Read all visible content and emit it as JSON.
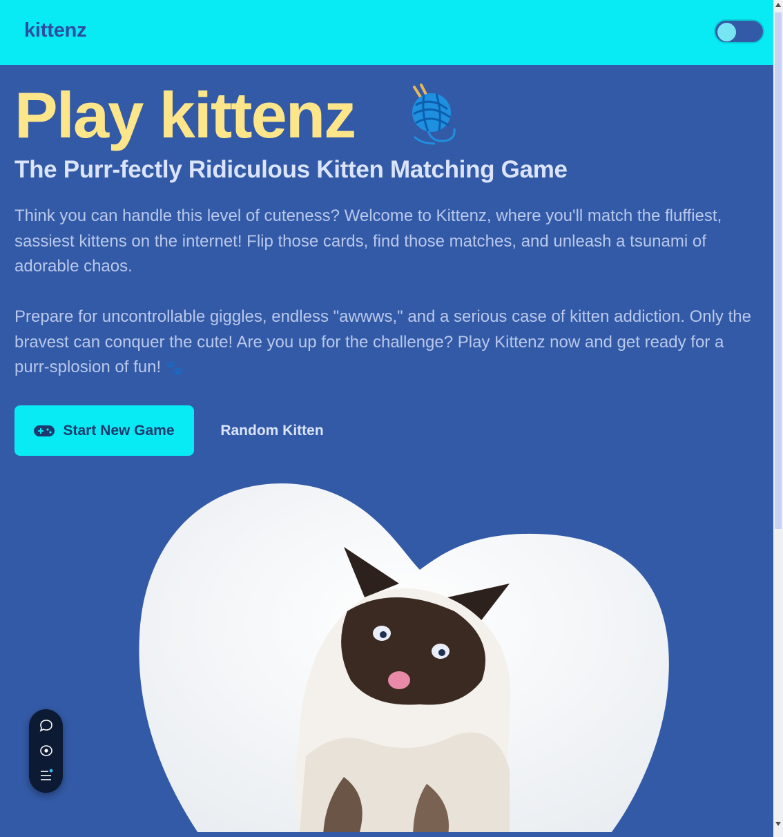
{
  "navbar": {
    "brand": "kittenz",
    "theme_toggle": "theme-toggle"
  },
  "hero": {
    "title": "Play kittenz",
    "subtitle": "The Purr-fectly Ridiculous Kitten Matching Game",
    "paragraph1": "Think you can handle this level of cuteness? Welcome to Kittenz, where you'll match the fluffiest, sassiest kittens on the internet! Flip those cards, find those matches, and unleash a tsunami of adorable chaos.",
    "paragraph2": "Prepare for uncontrollable giggles, endless \"awwws,\" and a serious case of kitten addiction. Only the bravest can conquer the cute! Are you up for the challenge? Play Kittenz now and get ready for a purr-splosion of fun!",
    "paragraph2_emoji": "🐾"
  },
  "actions": {
    "start_label": "Start New Game",
    "start_icon": "gamepad-icon",
    "random_label": "Random Kitten"
  },
  "image": {
    "icon": "yarn-ball-icon",
    "hero_image": "kitten-heart-image"
  },
  "dock": {
    "icons": [
      "chat-bubble-icon",
      "eye-icon",
      "menu-icon"
    ]
  },
  "colors": {
    "navbar": "#08ebf4",
    "background": "#335aa6",
    "title": "#fde68a",
    "button": "#08ebf4"
  }
}
